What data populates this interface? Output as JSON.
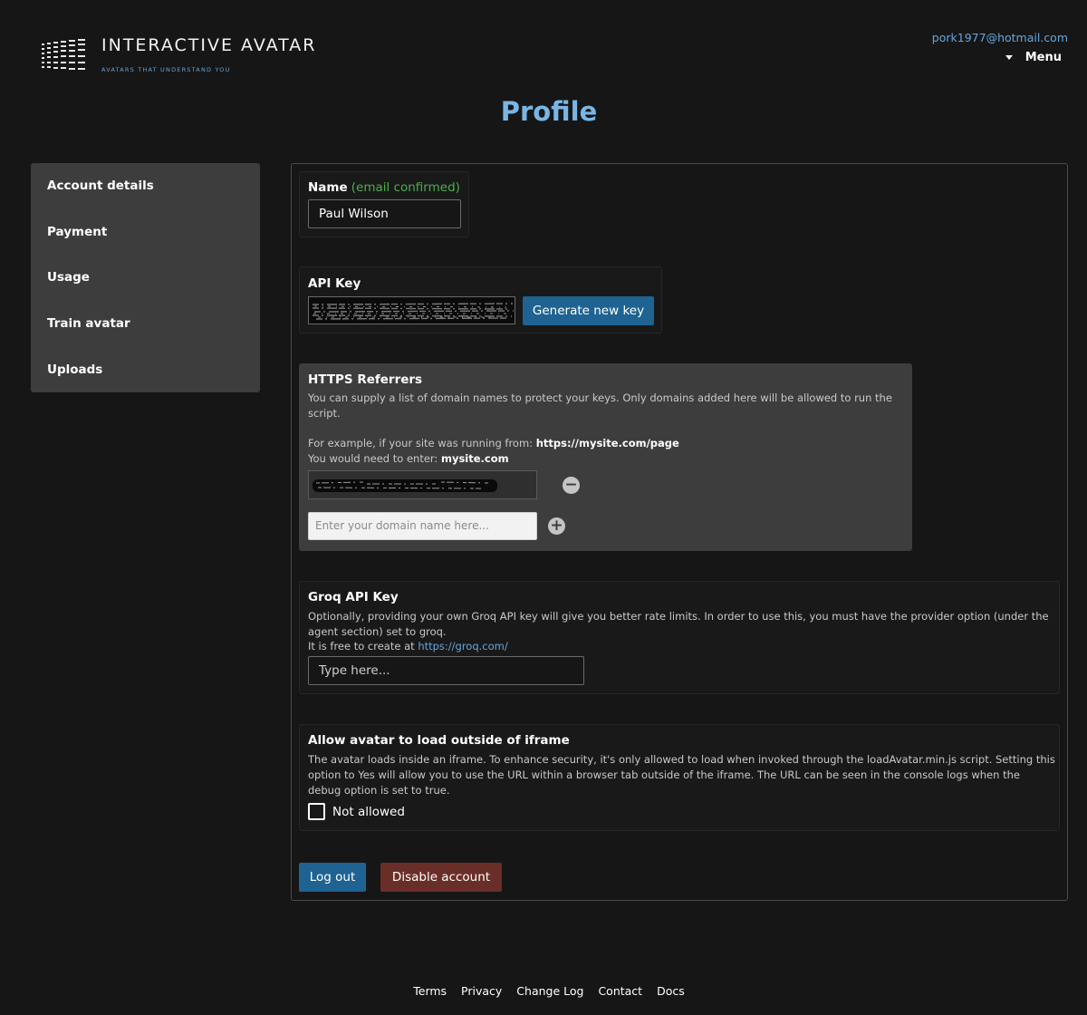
{
  "header": {
    "logo_title": "INTERACTIVE AVATAR",
    "logo_tagline": "AVATARS THAT UNDERSTAND YOU",
    "user_email": "pork1977@hotmail.com",
    "menu_label": "Menu"
  },
  "page_title": "Profile",
  "sidebar": {
    "items": [
      {
        "label": "Account details"
      },
      {
        "label": "Payment"
      },
      {
        "label": "Usage"
      },
      {
        "label": "Train avatar"
      },
      {
        "label": "Uploads"
      }
    ]
  },
  "name_section": {
    "label": "Name",
    "note": "(email confirmed)",
    "value": "Paul Wilson"
  },
  "api_key_section": {
    "label": "API Key",
    "generate_button": "Generate new key"
  },
  "referrers_section": {
    "label": "HTTPS Referrers",
    "help": "You can supply a list of domain names to protect your keys. Only domains added here will be allowed to run the script.",
    "example_prefix": "For example, if your site was running from:",
    "example_url": "https://mysite.com/page",
    "enter_prefix": "You would need to enter:",
    "enter_value": "mysite.com",
    "domain_placeholder": "Enter your domain name here..."
  },
  "groq_section": {
    "label": "Groq API Key",
    "help": "Optionally, providing your own Groq API key will give you better rate limits. In order to use this, you must have the provider option (under the agent section) set to groq.",
    "free_prefix": "It is free to create at",
    "free_link": "https://groq.com/",
    "placeholder": "Type here..."
  },
  "iframe_section": {
    "label": "Allow avatar to load outside of iframe",
    "help": "The avatar loads inside an iframe. To enhance security, it's only allowed to load when invoked through the loadAvatar.min.js script. Setting this option to Yes will allow you to use the URL within a browser tab outside of the iframe. The URL can be seen in the console logs when the debug option is set to true.",
    "checkbox_label": "Not allowed",
    "checked": false
  },
  "actions": {
    "logout": "Log out",
    "disable": "Disable account"
  },
  "footer": {
    "links": [
      "Terms",
      "Privacy",
      "Change Log",
      "Contact",
      "Docs"
    ]
  },
  "colors": {
    "background": "#161616",
    "accent_blue": "#1e6392",
    "title_blue": "#79b6e5",
    "danger": "#6a2e28",
    "confirmed_green": "#4caf50"
  }
}
